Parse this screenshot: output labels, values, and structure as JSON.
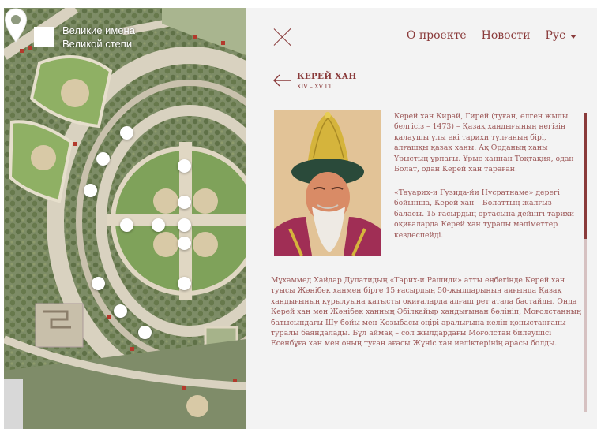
{
  "brand": {
    "line1": "Великие имена",
    "line2": "Великой степи"
  },
  "nav": {
    "about": "О проекте",
    "news": "Новости",
    "lang": "Рус"
  },
  "person": {
    "name": "КЕРЕЙ ХАН",
    "years": "XIV – XV ГГ."
  },
  "bio": {
    "p1": "Керей хан Кирай, Гирей (туған, өлген жылы белгісіз – 1473) – Қазақ хандығының негізін қалаушы ұлы екі тарихи тұлғаның бірі, алғашқы қазақ ханы. Ақ Орданың ханы Ұрыстың ұрпағы. Ұрыс ханнан Тоқтақия, одан Болат, одан Керей хан тараған.",
    "p2": "«Тауарих-и Гузида-йи Нусратнаме» дерегі бойынша, Керей хан – Болаттың жалғыз баласы. 15 ғасырдың ортасына дейінгі тарихи оқиғаларда Керей хан туралы мәліметтер кездеспейді.",
    "p3": "Мұхаммед Хайдар Дулатидың «Тарих-и Рашиди» атты еңбегінде Керей хан туысы Жәнібек ханмен бірге 15 ғасырдың 50-жылдарының аяғында Қазақ хандығының құрылуына қатысты оқиғаларда алғаш рет аталa бастайды. Онда Керей хан мен Жәнібек ханның Әбілқайыр хандығынан бөлініп, Моғолстанның батысындағы Шу бойы мен Қозыбасы өңірі аралығына келіп қоныстанғаны туралы баяндалады. Бұл аймақ – сол жылдардағы Моғолстан билеушісі Есенбұға хан мен оның туған ағасы Жүніс хан иеліктерінің арасы болды."
  },
  "icons": {
    "close": "close-icon",
    "back": "arrow-left-icon",
    "pin": "map-pin-icon",
    "caret": "chevron-down-icon"
  },
  "colors": {
    "accent": "#8a3a3a",
    "text": "#9c5757",
    "panel": "#f3f3f3"
  }
}
